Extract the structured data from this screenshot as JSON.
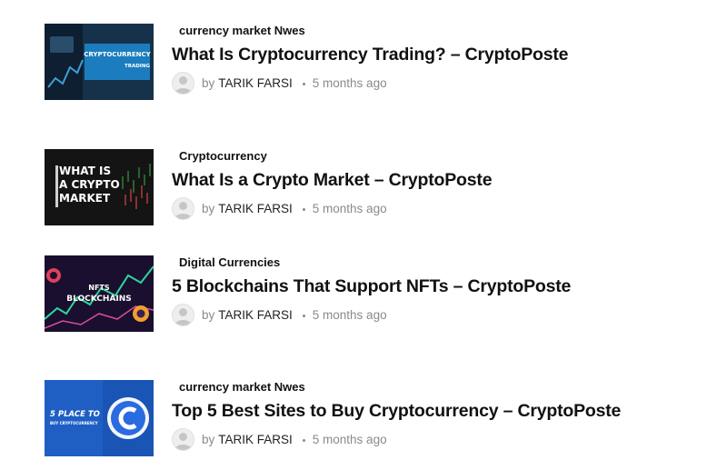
{
  "posts": [
    {
      "category": "currency market Nwes",
      "title": "What Is Cryptocurrency Trading? – CryptoPoste",
      "by_prefix": "by",
      "author": "TARIK FARSI",
      "date": "5 months ago",
      "thumb_text_line1": "CRYPTOCURRENCY",
      "thumb_text_line2": "TRADING"
    },
    {
      "category": "Cryptocurrency",
      "title": "What Is a Crypto Market – CryptoPoste",
      "by_prefix": "by",
      "author": "TARIK FARSI",
      "date": "5 months ago",
      "thumb_text_line1": "WHAT IS",
      "thumb_text_line2": "A CRYPTO",
      "thumb_text_line3": "MARKET"
    },
    {
      "category": "Digital Currencies",
      "title": "5 Blockchains That Support NFTs – CryptoPoste",
      "by_prefix": "by",
      "author": "TARIK FARSI",
      "date": "5 months ago",
      "thumb_text_line1": "NFTS",
      "thumb_text_line2": "BLOCKCHAINS"
    },
    {
      "category": "currency market Nwes",
      "title": "Top 5 Best Sites to Buy Cryptocurrency – CryptoPoste",
      "by_prefix": "by",
      "author": "TARIK FARSI",
      "date": "5 months ago",
      "thumb_text_line1": "5 PLACE TO",
      "thumb_text_line2": "BUY CRYPTOCURRENCY"
    }
  ],
  "colors": {
    "title": "#111111",
    "meta": "#8a8a8a",
    "thumb1_bg": "#16324a",
    "thumb2_bg": "#141414",
    "thumb3_bg": "#1a0f2e",
    "thumb4_bg": "#1f5fc4"
  }
}
